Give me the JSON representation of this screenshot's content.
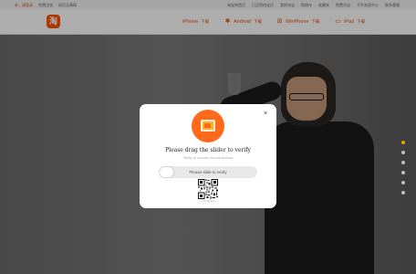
{
  "topbar": {
    "left": [
      "亲，请登录",
      "免费注册",
      "网页无障碍"
    ],
    "right": [
      "淘宝网首页",
      "已买到的宝贝",
      "我的淘宝",
      "购物车",
      "收藏夹",
      "免费开店",
      "千牛卖家中心",
      "联系客服"
    ]
  },
  "nav": {
    "logo": "淘",
    "downloads": [
      {
        "icon": "apple-icon",
        "glyph": "",
        "label": "iPhone",
        "sub": "下载"
      },
      {
        "icon": "android-icon",
        "glyph": "✱",
        "label": "Android",
        "sub": "下载"
      },
      {
        "icon": "windows-icon",
        "glyph": "⊞",
        "label": "WinPhone",
        "sub": "下载"
      },
      {
        "icon": "ipad-icon",
        "glyph": "▭",
        "label": "iPad",
        "sub": "下载"
      }
    ]
  },
  "modal": {
    "close": "×",
    "title": "Please drag the slider to verify",
    "subtitle": "Verify to ensure normal access",
    "slider_label": "Please slide to verify",
    "qr_caption": "Feedback"
  },
  "carousel": {
    "count": 6,
    "active": 0
  },
  "colors": {
    "accent": "#ff5000",
    "badge": "#ff6a1a"
  }
}
